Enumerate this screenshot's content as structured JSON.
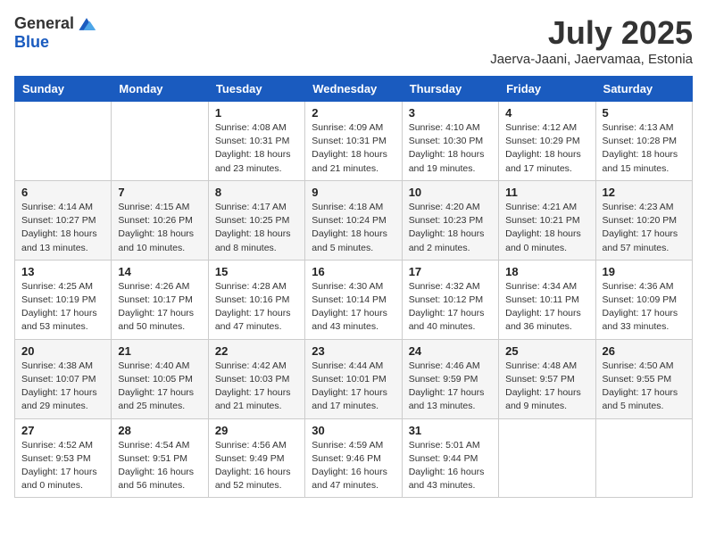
{
  "header": {
    "logo_general": "General",
    "logo_blue": "Blue",
    "month_title": "July 2025",
    "location": "Jaerva-Jaani, Jaervamaa, Estonia"
  },
  "weekdays": [
    "Sunday",
    "Monday",
    "Tuesday",
    "Wednesday",
    "Thursday",
    "Friday",
    "Saturday"
  ],
  "weeks": [
    [
      {
        "day": "",
        "info": ""
      },
      {
        "day": "",
        "info": ""
      },
      {
        "day": "1",
        "info": "Sunrise: 4:08 AM\nSunset: 10:31 PM\nDaylight: 18 hours\nand 23 minutes."
      },
      {
        "day": "2",
        "info": "Sunrise: 4:09 AM\nSunset: 10:31 PM\nDaylight: 18 hours\nand 21 minutes."
      },
      {
        "day": "3",
        "info": "Sunrise: 4:10 AM\nSunset: 10:30 PM\nDaylight: 18 hours\nand 19 minutes."
      },
      {
        "day": "4",
        "info": "Sunrise: 4:12 AM\nSunset: 10:29 PM\nDaylight: 18 hours\nand 17 minutes."
      },
      {
        "day": "5",
        "info": "Sunrise: 4:13 AM\nSunset: 10:28 PM\nDaylight: 18 hours\nand 15 minutes."
      }
    ],
    [
      {
        "day": "6",
        "info": "Sunrise: 4:14 AM\nSunset: 10:27 PM\nDaylight: 18 hours\nand 13 minutes."
      },
      {
        "day": "7",
        "info": "Sunrise: 4:15 AM\nSunset: 10:26 PM\nDaylight: 18 hours\nand 10 minutes."
      },
      {
        "day": "8",
        "info": "Sunrise: 4:17 AM\nSunset: 10:25 PM\nDaylight: 18 hours\nand 8 minutes."
      },
      {
        "day": "9",
        "info": "Sunrise: 4:18 AM\nSunset: 10:24 PM\nDaylight: 18 hours\nand 5 minutes."
      },
      {
        "day": "10",
        "info": "Sunrise: 4:20 AM\nSunset: 10:23 PM\nDaylight: 18 hours\nand 2 minutes."
      },
      {
        "day": "11",
        "info": "Sunrise: 4:21 AM\nSunset: 10:21 PM\nDaylight: 18 hours\nand 0 minutes."
      },
      {
        "day": "12",
        "info": "Sunrise: 4:23 AM\nSunset: 10:20 PM\nDaylight: 17 hours\nand 57 minutes."
      }
    ],
    [
      {
        "day": "13",
        "info": "Sunrise: 4:25 AM\nSunset: 10:19 PM\nDaylight: 17 hours\nand 53 minutes."
      },
      {
        "day": "14",
        "info": "Sunrise: 4:26 AM\nSunset: 10:17 PM\nDaylight: 17 hours\nand 50 minutes."
      },
      {
        "day": "15",
        "info": "Sunrise: 4:28 AM\nSunset: 10:16 PM\nDaylight: 17 hours\nand 47 minutes."
      },
      {
        "day": "16",
        "info": "Sunrise: 4:30 AM\nSunset: 10:14 PM\nDaylight: 17 hours\nand 43 minutes."
      },
      {
        "day": "17",
        "info": "Sunrise: 4:32 AM\nSunset: 10:12 PM\nDaylight: 17 hours\nand 40 minutes."
      },
      {
        "day": "18",
        "info": "Sunrise: 4:34 AM\nSunset: 10:11 PM\nDaylight: 17 hours\nand 36 minutes."
      },
      {
        "day": "19",
        "info": "Sunrise: 4:36 AM\nSunset: 10:09 PM\nDaylight: 17 hours\nand 33 minutes."
      }
    ],
    [
      {
        "day": "20",
        "info": "Sunrise: 4:38 AM\nSunset: 10:07 PM\nDaylight: 17 hours\nand 29 minutes."
      },
      {
        "day": "21",
        "info": "Sunrise: 4:40 AM\nSunset: 10:05 PM\nDaylight: 17 hours\nand 25 minutes."
      },
      {
        "day": "22",
        "info": "Sunrise: 4:42 AM\nSunset: 10:03 PM\nDaylight: 17 hours\nand 21 minutes."
      },
      {
        "day": "23",
        "info": "Sunrise: 4:44 AM\nSunset: 10:01 PM\nDaylight: 17 hours\nand 17 minutes."
      },
      {
        "day": "24",
        "info": "Sunrise: 4:46 AM\nSunset: 9:59 PM\nDaylight: 17 hours\nand 13 minutes."
      },
      {
        "day": "25",
        "info": "Sunrise: 4:48 AM\nSunset: 9:57 PM\nDaylight: 17 hours\nand 9 minutes."
      },
      {
        "day": "26",
        "info": "Sunrise: 4:50 AM\nSunset: 9:55 PM\nDaylight: 17 hours\nand 5 minutes."
      }
    ],
    [
      {
        "day": "27",
        "info": "Sunrise: 4:52 AM\nSunset: 9:53 PM\nDaylight: 17 hours\nand 0 minutes."
      },
      {
        "day": "28",
        "info": "Sunrise: 4:54 AM\nSunset: 9:51 PM\nDaylight: 16 hours\nand 56 minutes."
      },
      {
        "day": "29",
        "info": "Sunrise: 4:56 AM\nSunset: 9:49 PM\nDaylight: 16 hours\nand 52 minutes."
      },
      {
        "day": "30",
        "info": "Sunrise: 4:59 AM\nSunset: 9:46 PM\nDaylight: 16 hours\nand 47 minutes."
      },
      {
        "day": "31",
        "info": "Sunrise: 5:01 AM\nSunset: 9:44 PM\nDaylight: 16 hours\nand 43 minutes."
      },
      {
        "day": "",
        "info": ""
      },
      {
        "day": "",
        "info": ""
      }
    ]
  ]
}
